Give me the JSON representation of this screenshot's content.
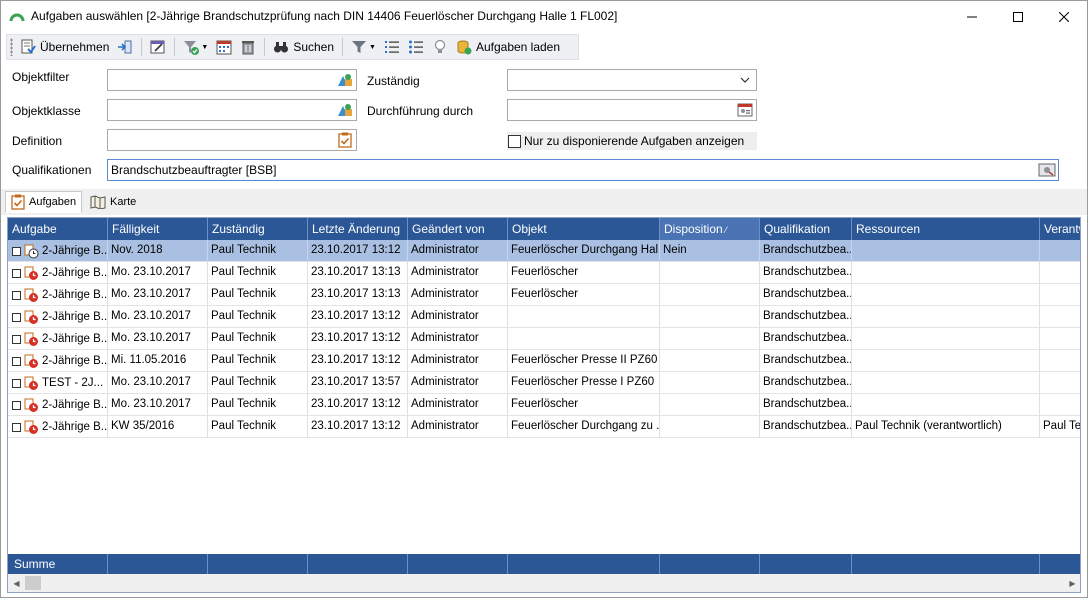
{
  "window": {
    "title": "Aufgaben auswählen [2-Jährige Brandschutzprüfung nach DIN 14406 Feuerlöscher Durchgang Halle 1 FL002]"
  },
  "toolbar": {
    "apply_label": "Übernehmen",
    "search_label": "Suchen",
    "load_tasks_label": "Aufgaben laden"
  },
  "filters": {
    "objektfilter": {
      "label": "Objektfilter",
      "value": ""
    },
    "objektklasse": {
      "label": "Objektklasse",
      "value": ""
    },
    "definition": {
      "label": "Definition",
      "value": ""
    },
    "qualifikationen": {
      "label": "Qualifikationen",
      "value": "Brandschutzbeauftragter [BSB]"
    },
    "zustaendig": {
      "label": "Zuständig",
      "value": ""
    },
    "durchfuehrung": {
      "label": "Durchführung durch",
      "value": ""
    },
    "nur_disponierende": {
      "label": "Nur zu disponierende Aufgaben anzeigen",
      "checked": false
    }
  },
  "tabs": [
    {
      "label": "Aufgaben",
      "active": true,
      "icon": "checklist-icon"
    },
    {
      "label": "Karte",
      "active": false,
      "icon": "map-icon"
    }
  ],
  "grid": {
    "columns": [
      "Aufgabe",
      "Fälligkeit",
      "Zuständig",
      "Letzte Änderung",
      "Geändert von",
      "Objekt",
      "Disposition",
      "Qualifikation",
      "Ressourcen",
      "Verantw"
    ],
    "sorted_column": "Disposition",
    "rows": [
      {
        "selected": true,
        "icon": "clock-task-icon",
        "cells": [
          "2-Jährige B...",
          "Nov. 2018",
          "Paul Technik",
          "23.10.2017 13:12",
          "Administrator",
          "Feuerlöscher Durchgang Hal...",
          "Nein",
          "Brandschutzbea...",
          "",
          ""
        ]
      },
      {
        "selected": false,
        "icon": "overdue-task-icon",
        "cells": [
          "2-Jährige B...",
          "Mo. 23.10.2017",
          "Paul Technik",
          "23.10.2017 13:13",
          "Administrator",
          "Feuerlöscher",
          "",
          "Brandschutzbea...",
          "",
          ""
        ]
      },
      {
        "selected": false,
        "icon": "overdue-task-icon",
        "cells": [
          "2-Jährige B...",
          "Mo. 23.10.2017",
          "Paul Technik",
          "23.10.2017 13:13",
          "Administrator",
          "Feuerlöscher",
          "",
          "Brandschutzbea...",
          "",
          ""
        ]
      },
      {
        "selected": false,
        "icon": "overdue-task-icon",
        "cells": [
          "2-Jährige B...",
          "Mo. 23.10.2017",
          "Paul Technik",
          "23.10.2017 13:12",
          "Administrator",
          "",
          "",
          "Brandschutzbea...",
          "",
          ""
        ]
      },
      {
        "selected": false,
        "icon": "overdue-task-icon",
        "cells": [
          "2-Jährige B...",
          "Mo. 23.10.2017",
          "Paul Technik",
          "23.10.2017 13:12",
          "Administrator",
          "",
          "",
          "Brandschutzbea...",
          "",
          ""
        ]
      },
      {
        "selected": false,
        "icon": "overdue-task-icon",
        "cells": [
          "2-Jährige B...",
          "Mi. 11.05.2016",
          "Paul Technik",
          "23.10.2017 13:12",
          "Administrator",
          "Feuerlöscher Presse  II PZ60",
          "",
          "Brandschutzbea...",
          "",
          ""
        ]
      },
      {
        "selected": false,
        "icon": "overdue-task-icon",
        "cells": [
          "TEST - 2J...",
          "Mo. 23.10.2017",
          "Paul Technik",
          "23.10.2017 13:57",
          "Administrator",
          "Feuerlöscher Presse I PZ60",
          "",
          "Brandschutzbea...",
          "",
          ""
        ]
      },
      {
        "selected": false,
        "icon": "overdue-task-icon",
        "cells": [
          "2-Jährige B...",
          "Mo. 23.10.2017",
          "Paul Technik",
          "23.10.2017 13:12",
          "Administrator",
          "Feuerlöscher",
          "",
          "Brandschutzbea...",
          "",
          ""
        ]
      },
      {
        "selected": false,
        "icon": "overdue-task-icon",
        "cells": [
          "2-Jährige B...",
          "KW 35/2016",
          "Paul Technik",
          "23.10.2017 13:12",
          "Administrator",
          "Feuerlöscher Durchgang zu ...",
          "",
          "Brandschutzbea...",
          "Paul Technik (verantwortlich)",
          "Paul Tec"
        ]
      }
    ],
    "summary_label": "Summe"
  },
  "colors": {
    "grid_header": "#2c5797",
    "selected_row": "#a9c0e2"
  }
}
